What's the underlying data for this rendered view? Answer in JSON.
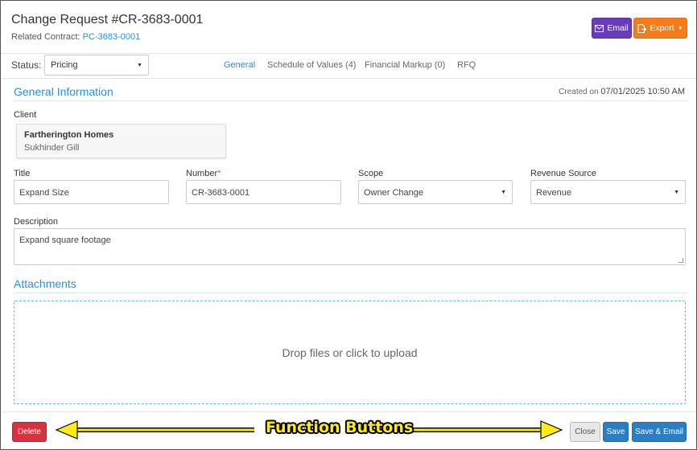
{
  "header": {
    "title": "Change Request #CR-3683-0001",
    "related_label": "Related Contract:",
    "related_link": "PC-3683-0001",
    "email_label": "Email",
    "export_label": "Export"
  },
  "status": {
    "label": "Status:",
    "value": "Pricing"
  },
  "tabs": [
    {
      "label": "General",
      "active": true
    },
    {
      "label": "Schedule of Values (4)",
      "active": false
    },
    {
      "label": "Financial Markup (0)",
      "active": false
    },
    {
      "label": "RFQ",
      "active": false
    }
  ],
  "general": {
    "section_title": "General Information",
    "created_prefix": "Created on",
    "created_value": "07/01/2025 10:50 AM",
    "client_label": "Client",
    "client_name": "Fartherington Homes",
    "client_person": "Sukhinder Gill",
    "title_label": "Title",
    "title_value": "Expand Size",
    "number_label": "Number",
    "number_required": "*",
    "number_value": "CR-3683-0001",
    "scope_label": "Scope",
    "scope_value": "Owner Change",
    "revenue_label": "Revenue Source",
    "revenue_value": "Revenue",
    "description_label": "Description",
    "description_value": "Expand square footage"
  },
  "attachments": {
    "section_title": "Attachments",
    "dropzone_text": "Drop files or click to upload"
  },
  "footer": {
    "delete_label": "Delete",
    "close_label": "Close",
    "save_label": "Save",
    "save_email_label": "Save & Email"
  },
  "annotation": {
    "label": "Function Buttons"
  },
  "colors": {
    "accent": "#2a8fd6",
    "email_button": "#6a3db8",
    "export_button": "#f57c1a",
    "delete_button": "#d9323f",
    "save_button": "#2a7fc4",
    "annotation": "#ffeb10"
  }
}
